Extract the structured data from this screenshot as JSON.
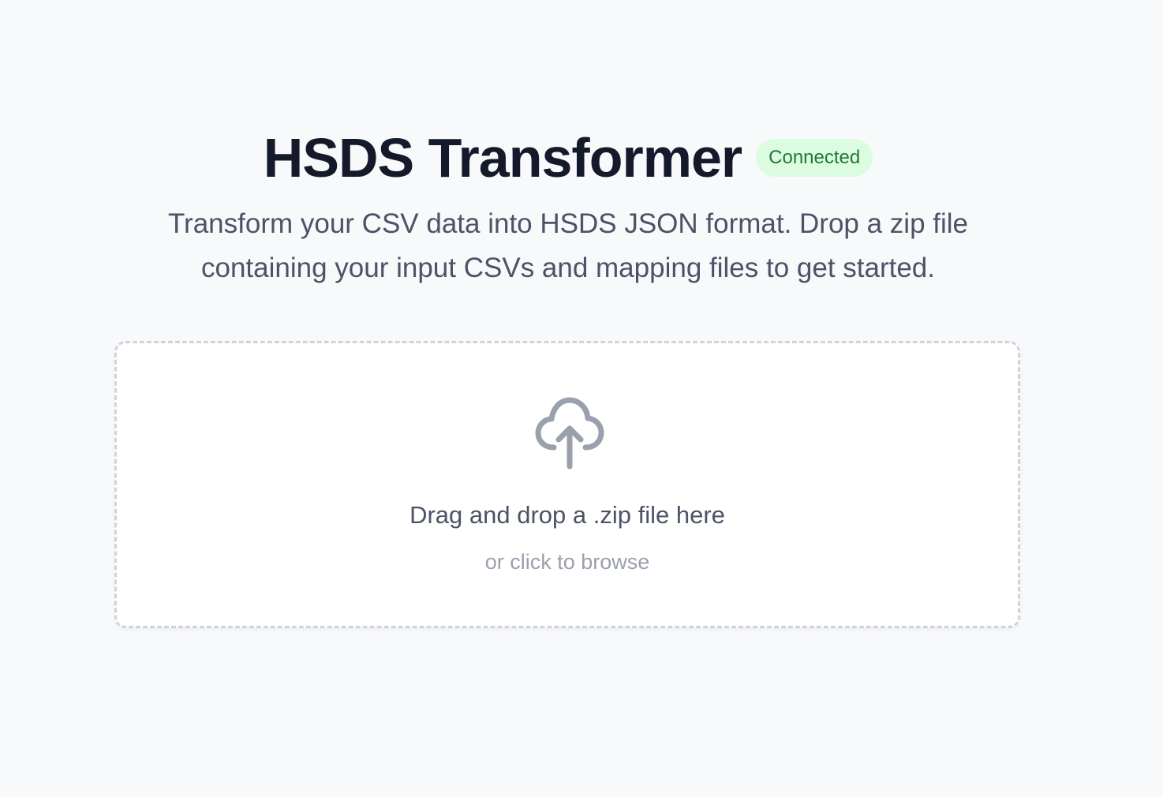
{
  "header": {
    "title": "HSDS Transformer",
    "status_badge": "Connected",
    "status_color": "#1f7a35",
    "status_bg": "#dcfce2"
  },
  "intro": {
    "line1": "Transform your CSV data into HSDS JSON format. Drop a zip file",
    "line2": "containing your input CSVs and mapping files to get started."
  },
  "dropzone": {
    "icon": "cloud-upload-icon",
    "primary_text": "Drag and drop a .zip file here",
    "secondary_text": "or click to browse"
  }
}
